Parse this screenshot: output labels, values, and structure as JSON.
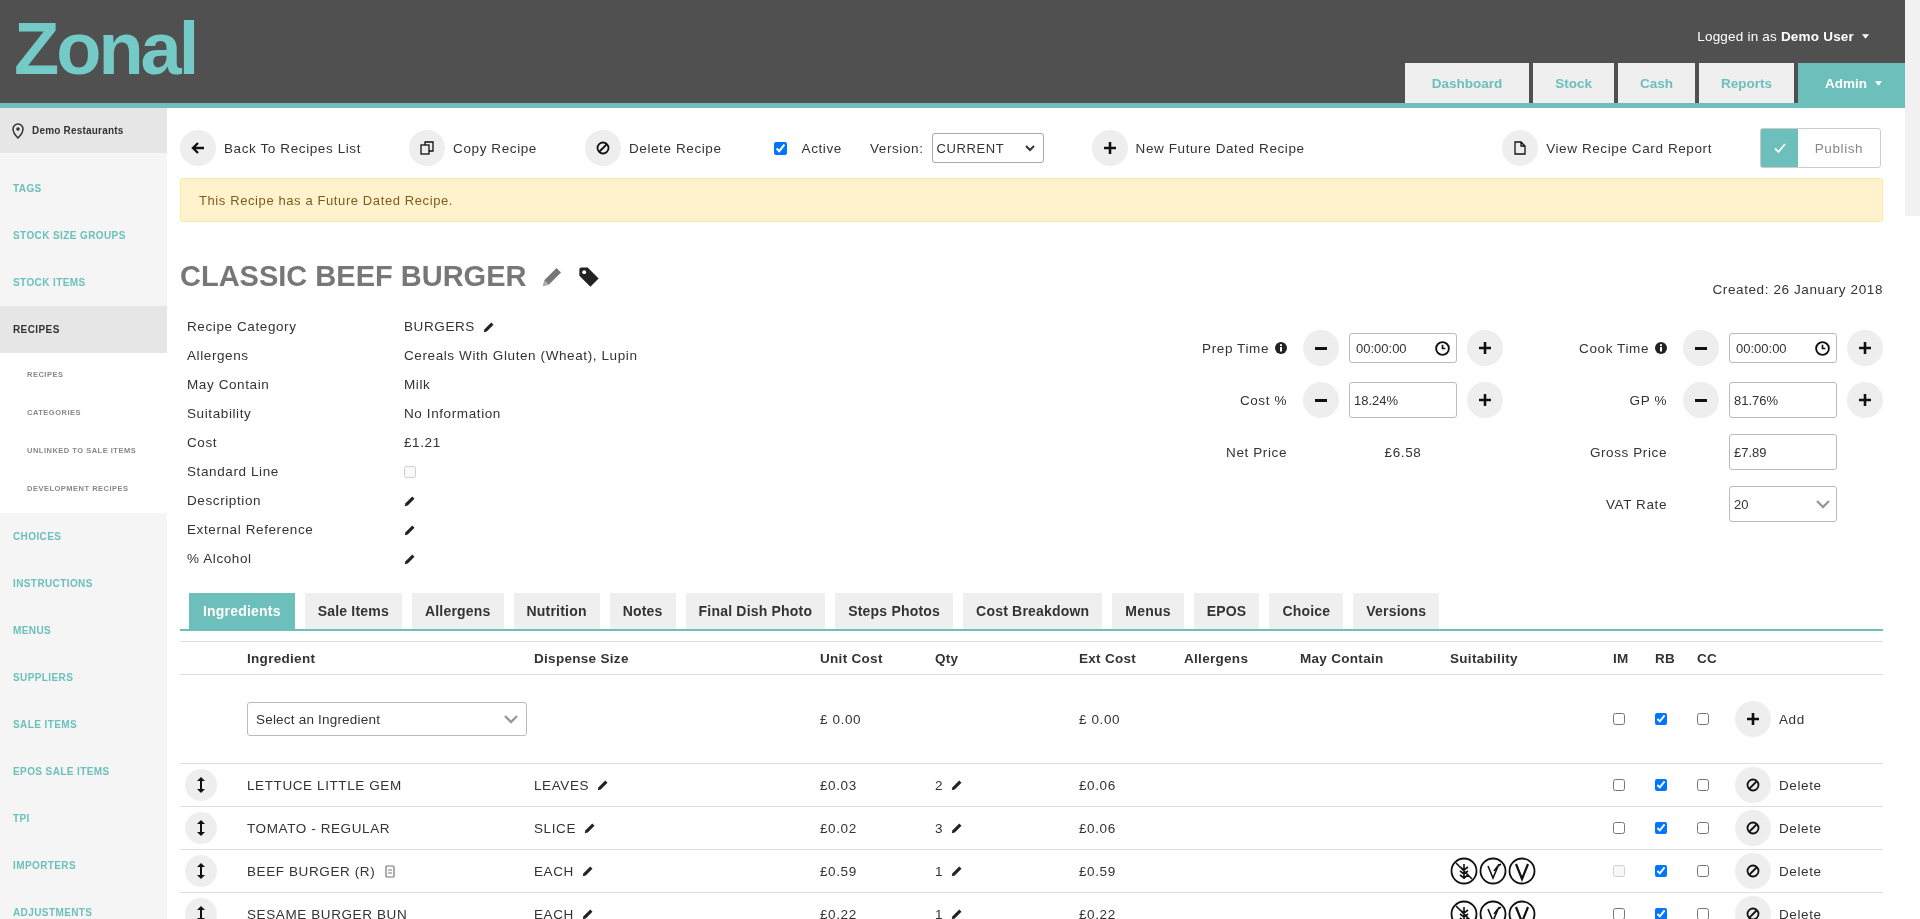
{
  "header": {
    "logo": "Zonal",
    "logged_in_prefix": "Logged in as",
    "user": "Demo User",
    "nav": [
      {
        "label": "Dashboard",
        "selected": false
      },
      {
        "label": "Stock",
        "selected": false
      },
      {
        "label": "Cash",
        "selected": false
      },
      {
        "label": "Reports",
        "selected": false
      },
      {
        "label": "Admin",
        "selected": true
      }
    ]
  },
  "sidebar": {
    "location": "Demo Restaurants",
    "items": [
      {
        "label": "TAGS",
        "selected": false
      },
      {
        "label": "STOCK SIZE GROUPS",
        "selected": false
      },
      {
        "label": "STOCK ITEMS",
        "selected": false
      },
      {
        "label": "RECIPES",
        "selected": true,
        "children": [
          {
            "label": "RECIPES",
            "selected": false
          },
          {
            "label": "CATEGORIES",
            "selected": false
          },
          {
            "label": "UNLINKED TO SALE ITEMS",
            "selected": false
          },
          {
            "label": "DEVELOPMENT RECIPES",
            "selected": false
          }
        ]
      },
      {
        "label": "CHOICES",
        "selected": false
      },
      {
        "label": "INSTRUCTIONS",
        "selected": false
      },
      {
        "label": "MENUS",
        "selected": false
      },
      {
        "label": "SUPPLIERS",
        "selected": false
      },
      {
        "label": "SALE ITEMS",
        "selected": false
      },
      {
        "label": "EPOS SALE ITEMS",
        "selected": false
      },
      {
        "label": "TPI",
        "selected": false
      },
      {
        "label": "IMPORTERS",
        "selected": false
      },
      {
        "label": "ADJUSTMENTS",
        "selected": false
      }
    ]
  },
  "toolbar": {
    "back": "Back To Recipes List",
    "copy": "Copy Recipe",
    "delete": "Delete Recipe",
    "active": {
      "label": "Active",
      "checked": true
    },
    "version": {
      "label": "Version:",
      "value": "CURRENT"
    },
    "new_future": "New Future Dated Recipe",
    "report": "View Recipe Card Report",
    "publish": {
      "label": "Publish",
      "checked": true
    }
  },
  "alert": "This Recipe has a Future Dated Recipe.",
  "recipe": {
    "title": "CLASSIC BEEF BURGER",
    "created": "Created: 26 January 2018",
    "details": [
      {
        "label": "Recipe Category",
        "kind": "text",
        "value": "BURGERS",
        "editable": true
      },
      {
        "label": "Allergens",
        "kind": "text",
        "value": "Cereals With Gluten (Wheat), Lupin",
        "editable": false
      },
      {
        "label": "May Contain",
        "kind": "text",
        "value": "Milk",
        "editable": false
      },
      {
        "label": "Suitability",
        "kind": "text",
        "value": "No Information",
        "editable": false
      },
      {
        "label": "Cost",
        "kind": "text",
        "value": "£1.21",
        "editable": false
      },
      {
        "label": "Standard Line",
        "kind": "checkbox",
        "checked": false
      },
      {
        "label": "Description",
        "kind": "text",
        "editable": true
      },
      {
        "label": "External Reference",
        "kind": "text",
        "editable": true
      },
      {
        "label": "% Alcohol",
        "kind": "text",
        "editable": true
      }
    ]
  },
  "pricing": {
    "prep_time": {
      "label": "Prep Time",
      "value": "00:00:00"
    },
    "cook_time": {
      "label": "Cook Time",
      "value": "00:00:00"
    },
    "cost_pct": {
      "label": "Cost %",
      "value": "18.24%"
    },
    "gp_pct": {
      "label": "GP %",
      "value": "81.76%"
    },
    "net_price": {
      "label": "Net Price",
      "value": "£6.58"
    },
    "gross_price": {
      "label": "Gross Price",
      "value": "£7.89"
    },
    "vat_rate": {
      "label": "VAT Rate",
      "value": "20"
    }
  },
  "tabs": [
    {
      "label": "Ingredients",
      "selected": true
    },
    {
      "label": "Sale Items",
      "selected": false
    },
    {
      "label": "Allergens",
      "selected": false
    },
    {
      "label": "Nutrition",
      "selected": false
    },
    {
      "label": "Notes",
      "selected": false
    },
    {
      "label": "Final Dish Photo",
      "selected": false
    },
    {
      "label": "Steps Photos",
      "selected": false
    },
    {
      "label": "Cost Breakdown",
      "selected": false
    },
    {
      "label": "Menus",
      "selected": false
    },
    {
      "label": "EPOS",
      "selected": false
    },
    {
      "label": "Choice",
      "selected": false
    },
    {
      "label": "Versions",
      "selected": false
    }
  ],
  "table": {
    "columns": [
      "Ingredient",
      "Dispense Size",
      "Unit Cost",
      "Qty",
      "Ext Cost",
      "Allergens",
      "May Contain",
      "Suitability",
      "IM",
      "RB",
      "CC"
    ],
    "new_row": {
      "placeholder": "Select an Ingredient",
      "unit_cost": "£ 0.00",
      "ext_cost": "£ 0.00",
      "im": false,
      "rb": true,
      "cc": false,
      "action": "Add"
    },
    "rows": [
      {
        "ingredient": "LETTUCE LITTLE GEM",
        "sub_recipe": false,
        "dispense": "LEAVES",
        "unit_cost": "£0.03",
        "qty": "2",
        "ext_cost": "£0.06",
        "suitability_icons": false,
        "im": false,
        "im_disabled": false,
        "rb": true,
        "cc": false,
        "action": "Delete"
      },
      {
        "ingredient": "TOMATO - REGULAR",
        "sub_recipe": false,
        "dispense": "SLICE",
        "unit_cost": "£0.02",
        "qty": "3",
        "ext_cost": "£0.06",
        "suitability_icons": false,
        "im": false,
        "im_disabled": false,
        "rb": true,
        "cc": false,
        "action": "Delete"
      },
      {
        "ingredient": "BEEF BURGER (R)",
        "sub_recipe": true,
        "dispense": "EACH",
        "unit_cost": "£0.59",
        "qty": "1",
        "ext_cost": "£0.59",
        "suitability_icons": true,
        "im": false,
        "im_disabled": true,
        "rb": true,
        "cc": false,
        "action": "Delete"
      },
      {
        "ingredient": "SESAME BURGER BUN",
        "sub_recipe": false,
        "dispense": "EACH",
        "unit_cost": "£0.22",
        "qty": "1",
        "ext_cost": "£0.22",
        "suitability_icons": true,
        "im": false,
        "im_disabled": false,
        "rb": true,
        "cc": false,
        "action": "Delete"
      }
    ]
  }
}
